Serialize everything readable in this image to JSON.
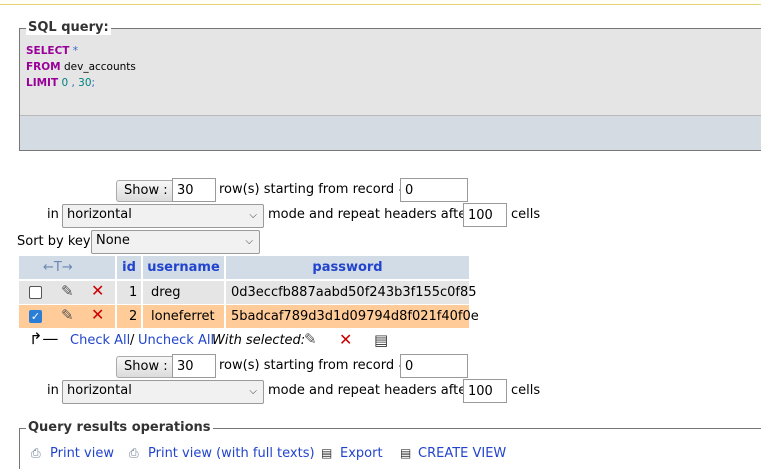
{
  "sql": {
    "legend": "SQL query:",
    "line1_kw": "SELECT",
    "line1_rest": " *",
    "line2_kw": "FROM",
    "line2_rest": " dev_accounts",
    "line3_kw": "LIMIT",
    "line3_a": " 0",
    "line3_b": " , ",
    "line3_c": "30",
    "line3_end": ";"
  },
  "nav_top": {
    "show_label": "Show :",
    "rows_value": "30",
    "rows_text": "row(s) starting from record #",
    "start_value": "0",
    "in_text": "in",
    "mode_value": "horizontal",
    "mode_text": "mode and repeat headers after",
    "repeat_value": "100",
    "cells_text": "cells"
  },
  "sort": {
    "label": "Sort by key:",
    "value": "None"
  },
  "table": {
    "columns": [
      "id",
      "username",
      "password"
    ],
    "rows": [
      {
        "id": "1",
        "username": "dreg",
        "password": "0d3eccfb887aabd50f243b3f155c0f85",
        "checked": false
      },
      {
        "id": "2",
        "username": "loneferret",
        "password": "5badcaf789d3d1d09794d8f021f40f0e",
        "checked": true
      }
    ]
  },
  "bulk": {
    "check_all": "Check All",
    "sep": "/",
    "uncheck_all": "Uncheck All",
    "with_selected": "With selected:"
  },
  "nav_bottom": {
    "show_label": "Show :",
    "rows_value": "30",
    "rows_text": "row(s) starting from record #",
    "start_value": "0",
    "in_text": "in",
    "mode_value": "horizontal",
    "mode_text": "mode and repeat headers after",
    "repeat_value": "100",
    "cells_text": "cells"
  },
  "ops": {
    "legend": "Query results operations",
    "items": [
      "Print view",
      "Print view (with full texts)",
      "Export",
      "CREATE VIEW"
    ]
  },
  "colors": {
    "header_bg": "#d2dce6",
    "row_even": "#e5e5e5",
    "row_selected": "#ffcc99",
    "link": "#2244cc"
  }
}
